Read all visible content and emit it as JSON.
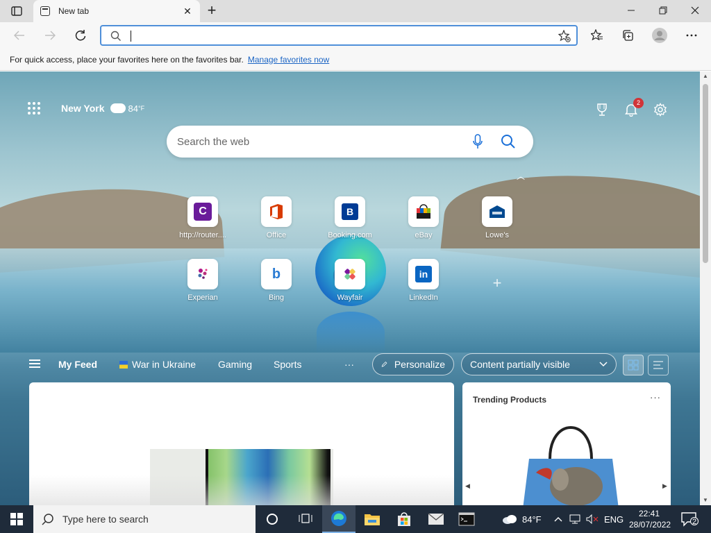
{
  "browser": {
    "tab": {
      "title": "New tab"
    },
    "address": {
      "value": ""
    },
    "favorites_bar": {
      "message": "For quick access, place your favorites here on the favorites bar.",
      "link": "Manage favorites now"
    }
  },
  "ntp": {
    "weather": {
      "city": "New York",
      "temp": "84",
      "unit": "°F"
    },
    "notification_count": "2",
    "search": {
      "placeholder": "Search the web"
    },
    "tiles": [
      {
        "label": "http://router....",
        "letter": "C",
        "color": "#6a1b9a",
        "icon": "c-icon"
      },
      {
        "label": "Office",
        "letter": "O",
        "color": "#d83b01",
        "icon": "office-icon"
      },
      {
        "label": "Booking.com",
        "letter": "B",
        "color": "#003b95",
        "icon": "booking-icon"
      },
      {
        "label": "eBay",
        "letter": "",
        "color": "#e53238",
        "icon": "ebay-bag-icon"
      },
      {
        "label": "Lowe's",
        "letter": "",
        "color": "#004990",
        "icon": "lowes-icon"
      },
      {
        "label": "Experian",
        "letter": "",
        "color": "#af1685",
        "icon": "experian-icon"
      },
      {
        "label": "Bing",
        "letter": "b",
        "color": "#2b7cd3",
        "icon": "bing-icon"
      },
      {
        "label": "Wayfair",
        "letter": "",
        "color": "#7b189f",
        "icon": "wayfair-icon"
      },
      {
        "label": "LinkedIn",
        "letter": "in",
        "color": "#0a66c2",
        "icon": "linkedin-icon"
      }
    ],
    "feed": {
      "items": [
        "My Feed",
        "War in Ukraine",
        "Gaming",
        "Sports"
      ],
      "more": "···",
      "personalize": "Personalize",
      "content_visibility": "Content partially visible"
    },
    "trending_card": {
      "title": "Trending Products",
      "more": "···"
    }
  },
  "taskbar": {
    "search_placeholder": "Type here to search",
    "weather": "84°F",
    "language": "ENG",
    "time": "22:41",
    "date": "28/07/2022",
    "notifications": "2"
  }
}
